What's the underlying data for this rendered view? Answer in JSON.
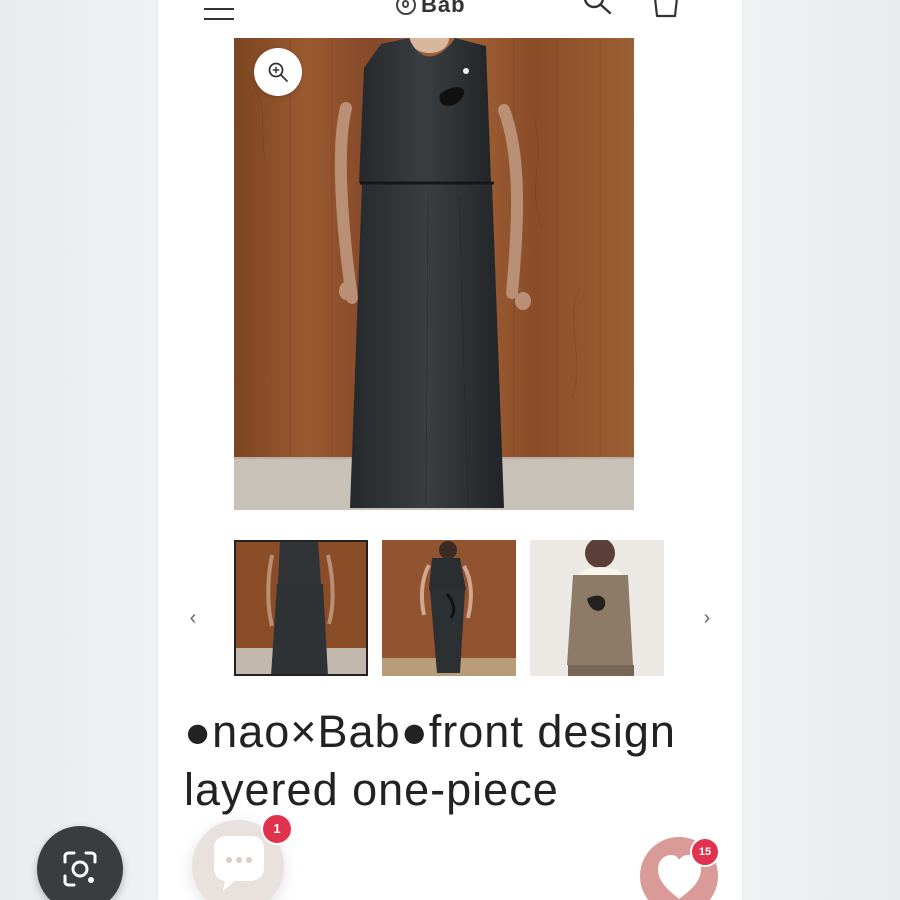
{
  "brand": {
    "name": "Bab"
  },
  "header": {
    "menu_icon": "hamburger-menu-icon",
    "search_icon": "search-icon",
    "cart_icon": "shopping-bag-icon"
  },
  "gallery": {
    "zoom_icon": "zoom-in-icon",
    "prev_label": "‹",
    "next_label": "›",
    "thumbnails": [
      {
        "name": "front view thumbnail",
        "active": true
      },
      {
        "name": "side view thumbnail",
        "active": false
      },
      {
        "name": "detail view thumbnail",
        "active": false
      }
    ]
  },
  "product": {
    "title": "●nao×Bab●front design layered one-piece"
  },
  "overlay": {
    "chat_badge": "1",
    "wishlist_badge": "15",
    "lens_icon": "google-lens-icon",
    "chat_icon": "chat-bubble-icon",
    "heart_icon": "heart-icon"
  },
  "colors": {
    "page_background": "#ffffff",
    "outer_background": "#eef2f3",
    "wood": "#8c4f28",
    "dress": "#2f3235",
    "badge": "#e1324e",
    "wishlist_button": "#d99a98"
  }
}
